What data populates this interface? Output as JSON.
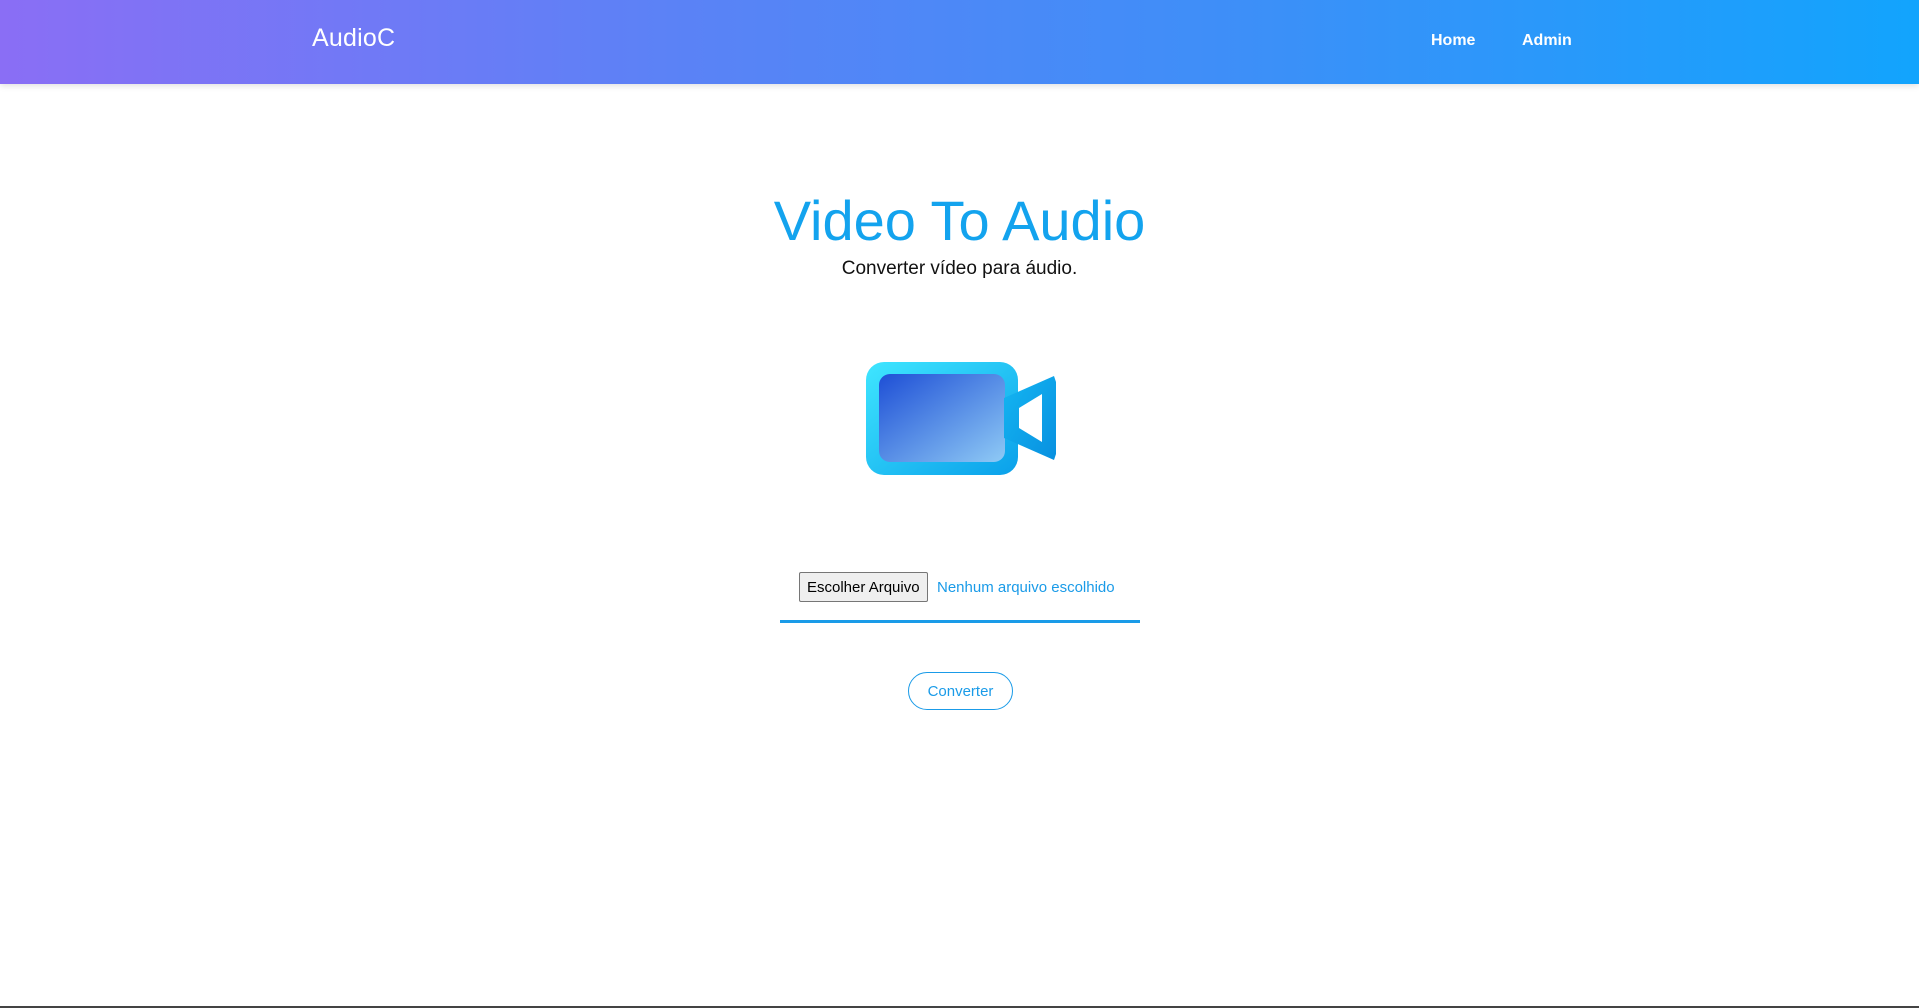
{
  "navbar": {
    "brand": "AudioC",
    "links": [
      {
        "label": "Home"
      },
      {
        "label": "Admin"
      }
    ]
  },
  "hero": {
    "title": "Video To Audio",
    "subtitle": "Converter vídeo para áudio.",
    "icon": "video-camera-icon"
  },
  "upload": {
    "choose_label": "Escolher Arquivo",
    "status_text": "Nenhum arquivo escolhido"
  },
  "actions": {
    "convert_label": "Converter"
  },
  "colors": {
    "accent": "#13a3ee",
    "nav_gradient_start": "#8a6ef5",
    "nav_gradient_end": "#12a4fd"
  }
}
